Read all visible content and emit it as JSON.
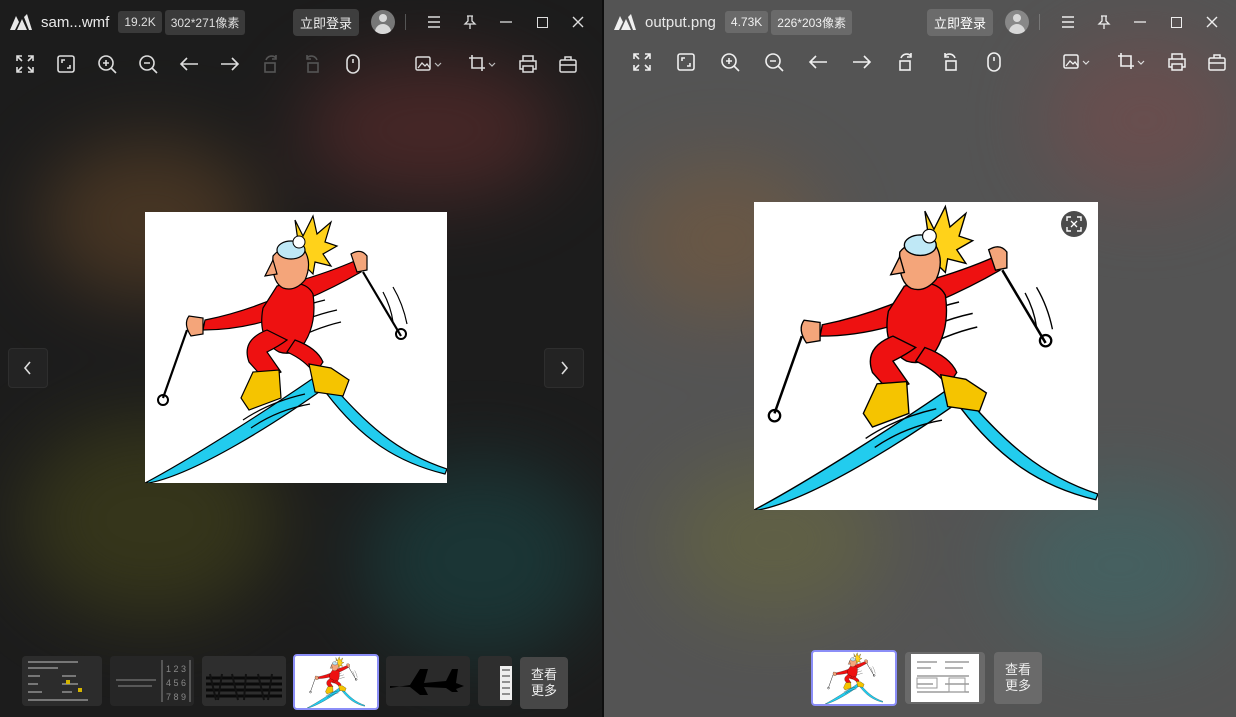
{
  "left": {
    "filename": "sam...wmf",
    "size": "19.2K",
    "dimensions": "302*271像素",
    "login": "立即登录",
    "more_label_1": "查看",
    "more_label_2": "更多"
  },
  "right": {
    "filename": "output.png",
    "size": "4.73K",
    "dimensions": "226*203像素",
    "login": "立即登录",
    "more_label_1": "查看",
    "more_label_2": "更多"
  },
  "colors": {
    "accent": "#8b8ef7",
    "skier_suit": "#ee1111",
    "skis": "#22ccee",
    "boots": "#f5c400"
  },
  "thumb_text": {
    "matrix": [
      "1 2 3",
      "4 5 6",
      "7 8 9"
    ]
  }
}
